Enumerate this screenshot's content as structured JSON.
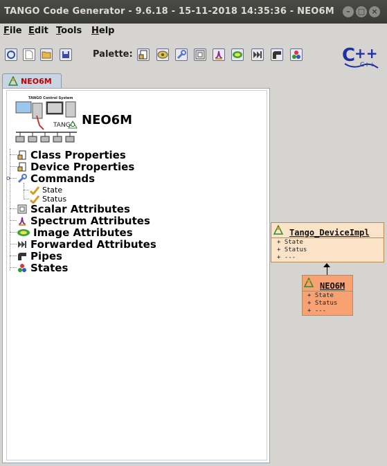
{
  "window": {
    "title": "TANGO Code Generator - 9.6.18  -  15-11-2018  14:35:36 - NEO6M",
    "buttons": [
      "minimize",
      "maximize",
      "close"
    ]
  },
  "menu": {
    "file": {
      "first": "F",
      "rest": "ile"
    },
    "edit": {
      "first": "E",
      "rest": "dit"
    },
    "tools": {
      "first": "T",
      "rest": "ools"
    },
    "help": {
      "first": "H",
      "rest": "elp"
    }
  },
  "toolbar": {
    "palette_label": "Palette:",
    "buttons": [
      "reload-icon",
      "new-file-icon",
      "open-folder-icon",
      "save-icon"
    ],
    "palette": [
      "class-property-icon",
      "device-property-icon",
      "command-icon",
      "scalar-attribute-icon",
      "spectrum-attribute-icon",
      "image-attribute-icon",
      "forwarded-attribute-icon",
      "pipe-icon",
      "states-icon"
    ],
    "language_logo": "C++"
  },
  "tab": {
    "label": "NEO6M"
  },
  "tree": {
    "logo_text": "TANGO Control System",
    "logo_caption": "TANGO",
    "root": "NEO6M",
    "nodes": [
      {
        "label": "Class Properties"
      },
      {
        "label": "Device Properties"
      },
      {
        "label": "Commands",
        "children": [
          "State",
          "Status"
        ]
      },
      {
        "label": "Scalar Attributes"
      },
      {
        "label": "Spectrum Attributes"
      },
      {
        "label": "Image Attributes"
      },
      {
        "label": "Forwarded Attributes"
      },
      {
        "label": "Pipes"
      },
      {
        "label": "States"
      }
    ]
  },
  "diagram": {
    "parent": {
      "title": "Tango_DeviceImpl",
      "attrs": [
        "+ State",
        "+ Status",
        "+ ---"
      ]
    },
    "child": {
      "title": "NEO6M",
      "attrs": [
        "+ State",
        "+ Status",
        "+ ---"
      ]
    }
  },
  "colors": {
    "titlebar": "#3c3b37",
    "tab_text": "#c00000",
    "parent_box": "#fbe3c7",
    "child_box": "#f8a274"
  }
}
